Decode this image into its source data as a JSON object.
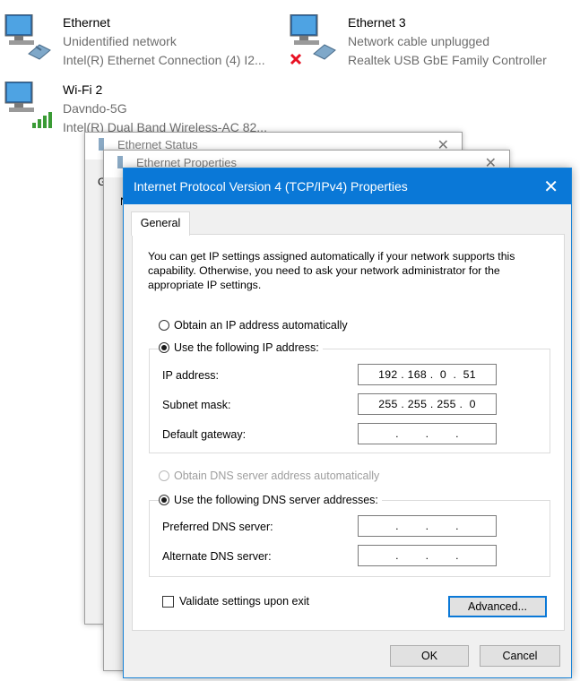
{
  "adapters": [
    {
      "name": "Ethernet",
      "status": "Unidentified network",
      "device": "Intel(R) Ethernet Connection (4) I2..."
    },
    {
      "name": "Ethernet 3",
      "status": "Network cable unplugged",
      "device": "Realtek USB GbE Family Controller"
    },
    {
      "name": "Wi-Fi 2",
      "status": "Davndo-5G",
      "device": "Intel(R) Dual Band Wireless-AC 82..."
    }
  ],
  "bg_windows": {
    "status_title": "Ethernet Status",
    "status_tab_fragment": "G",
    "properties_title": "Ethernet Properties",
    "properties_tab_fragment": "N"
  },
  "dialog": {
    "title": "Internet Protocol Version 4 (TCP/IPv4) Properties",
    "close_glyph": "✕",
    "tab": "General",
    "intro": "You can get IP settings assigned automatically if your network supports this capability. Otherwise, you need to ask your network administrator for the appropriate IP settings.",
    "ip_auto_label": "Obtain an IP address automatically",
    "ip_manual_label": "Use the following IP address:",
    "ip_address_label": "IP address:",
    "ip_address_value": "192 . 168 .  0  .  51",
    "subnet_label": "Subnet mask:",
    "subnet_value": "255 . 255 . 255 .  0",
    "gateway_label": "Default gateway:",
    "gateway_value": "  .        .        .  ",
    "dns_auto_label": "Obtain DNS server address automatically",
    "dns_manual_label": "Use the following DNS server addresses:",
    "preferred_dns_label": "Preferred DNS server:",
    "preferred_dns_value": "  .        .        .  ",
    "alternate_dns_label": "Alternate DNS server:",
    "alternate_dns_value": "  .        .        .  ",
    "validate_label": "Validate settings upon exit",
    "advanced_label": "Advanced...",
    "ok_label": "OK",
    "cancel_label": "Cancel"
  },
  "colors": {
    "accent": "#0a78d7",
    "window_bg": "#f0f0f0",
    "error_x": "#e81123",
    "wifi_bars": "#3a9b35"
  }
}
